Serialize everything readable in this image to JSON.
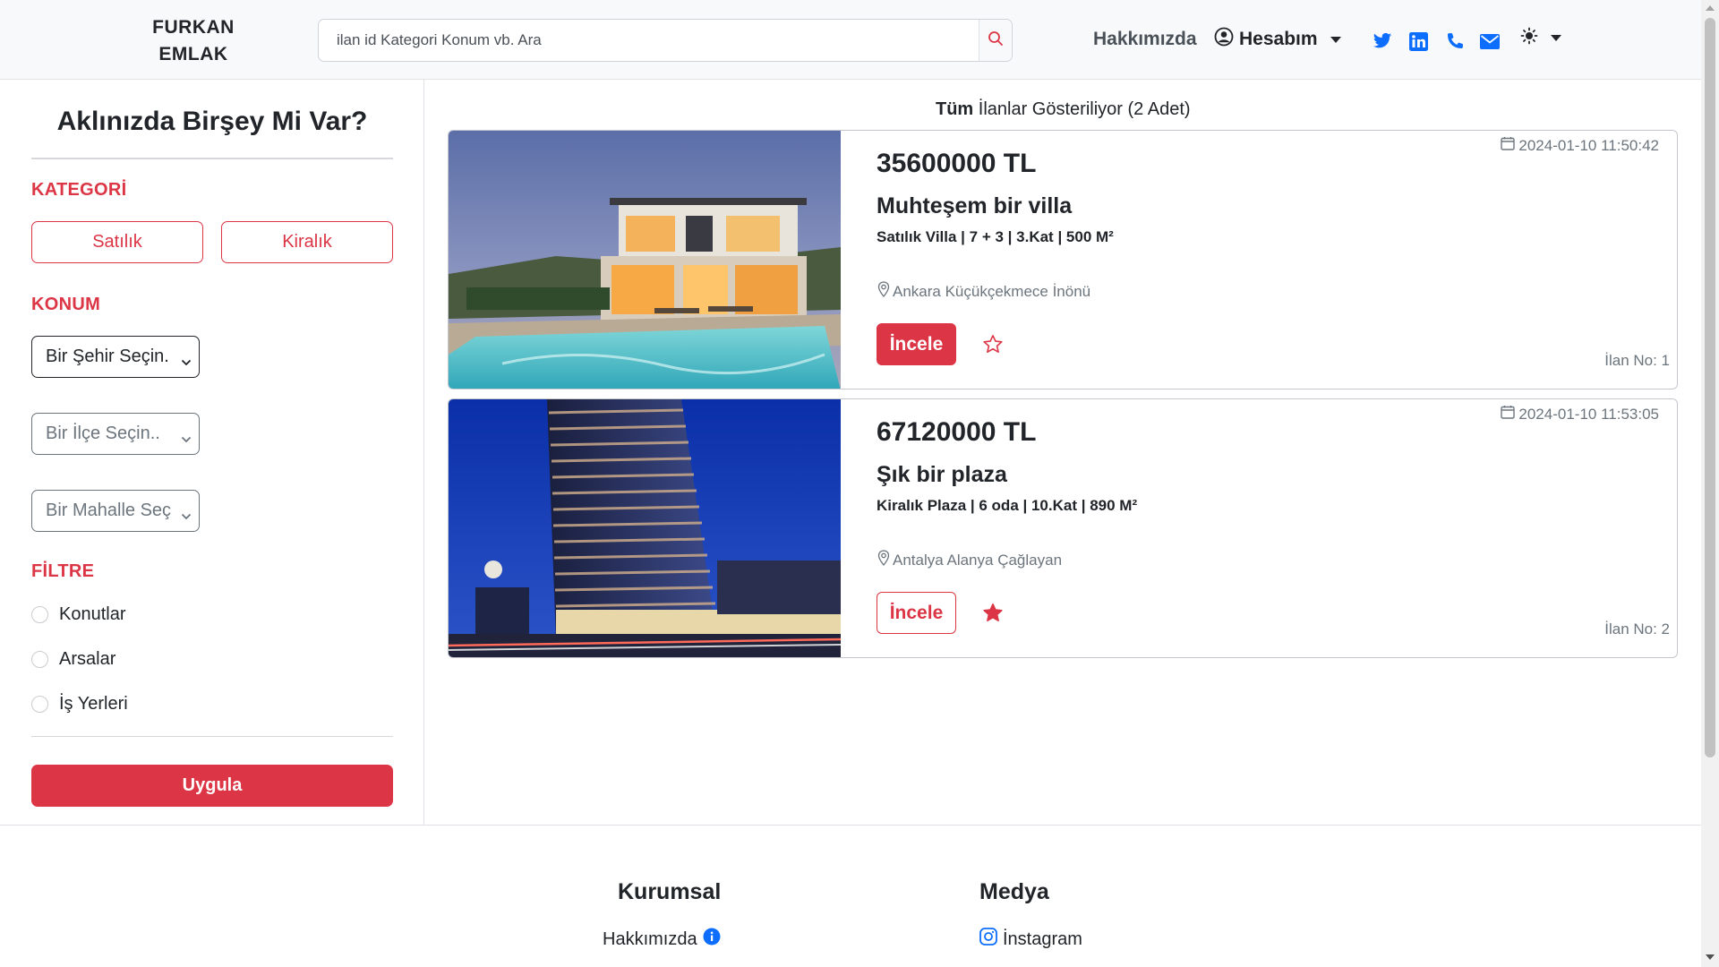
{
  "navbar": {
    "brand_line1": "FURKAN",
    "brand_line2": "EMLAK",
    "search_placeholder": "ilan id Kategori Konum vb. Ara",
    "about": "Hakkımızda",
    "account": "Hesabım",
    "social_icons": [
      "twitter-icon",
      "linkedin-icon",
      "phone-icon",
      "mail-icon"
    ],
    "theme_icon": "sun-icon"
  },
  "sidebar": {
    "title": "Aklınızda Birşey Mi Var?",
    "category_heading": "KATEGORİ",
    "category_buttons": [
      "Satılık",
      "Kiralık"
    ],
    "location_heading": "KONUM",
    "city_select": "Bir Şehir Seçin.",
    "district_select": "Bir İlçe Seçin..",
    "neighborhood_select": "Bir Mahalle Seç",
    "filter_heading": "FİLTRE",
    "filters": [
      "Konutlar",
      "Arsalar",
      "İş Yerleri"
    ],
    "apply": "Uygula"
  },
  "listings": {
    "header_bold": "Tüm",
    "header_rest": "İlanlar Gösteriliyor (2 Adet)",
    "items": [
      {
        "date": "2024-01-10 11:50:42",
        "price": "35600000 TL",
        "title": "Muhteşem bir villa",
        "specs": "Satılık Villa | 7 + 3 | 3.Kat | 500 M²",
        "location": "Ankara Küçükçekmece İnönü",
        "button": "İncele",
        "favorited": false,
        "listing_no": "İlan No: 1"
      },
      {
        "date": "2024-01-10 11:53:05",
        "price": "67120000 TL",
        "title": "Şık bir plaza",
        "specs": "Kiralık Plaza | 6 oda | 10.Kat | 890 M²",
        "location": "Antalya Alanya Çağlayan",
        "button": "İncele",
        "favorited": true,
        "listing_no": "İlan No: 2"
      }
    ]
  },
  "footer": {
    "corporate_heading": "Kurumsal",
    "corporate_link": "Hakkımızda",
    "media_heading": "Medya",
    "media_link": "İnstagram"
  },
  "colors": {
    "accent": "#dc3545",
    "navbar_bg": "#f8f9fa",
    "icon_blue": "#0d6efd"
  }
}
